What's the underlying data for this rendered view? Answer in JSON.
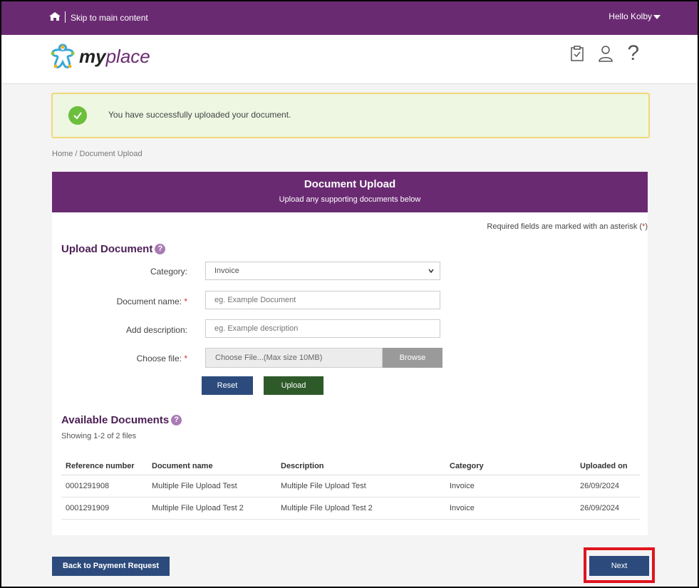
{
  "topbar": {
    "skip": "Skip to main content",
    "greeting": "Hello Kolby"
  },
  "brand": {
    "my": "my",
    "place": "place"
  },
  "alert": {
    "message": "You have successfully uploaded your document."
  },
  "breadcrumb": "Home  /  Document Upload",
  "panel": {
    "title": "Document Upload",
    "subtitle": "Upload any supporting documents below"
  },
  "required_note": {
    "text": "Required fields are marked with an asterisk (",
    "star": "*",
    "end": ")"
  },
  "upload_section": {
    "heading": "Upload Document",
    "help": "?",
    "category_label": "Category:",
    "category_value": "Invoice",
    "doc_name_label": "Document name:",
    "doc_name_placeholder": "eg. Example Document",
    "description_label": "Add description:",
    "description_placeholder": "eg. Example description",
    "file_label": "Choose file:",
    "file_placeholder": "Choose File...(Max size 10MB)",
    "browse": "Browse",
    "star": "*",
    "reset": "Reset",
    "upload": "Upload"
  },
  "documents": {
    "heading": "Available Documents",
    "help": "?",
    "showing": "Showing 1-2 of 2 files",
    "columns": [
      "Reference number",
      "Document name",
      "Description",
      "Category",
      "Uploaded on"
    ],
    "rows": [
      [
        "0001291908",
        "Multiple File Upload Test",
        "Multiple File Upload Test",
        "Invoice",
        "26/09/2024"
      ],
      [
        "0001291909",
        "Multiple File Upload Test 2",
        "Multiple File Upload Test 2",
        "Invoice",
        "26/09/2024"
      ]
    ]
  },
  "footer": {
    "back": "Back to Payment Request",
    "next": "Next"
  },
  "colors": {
    "brand": "#6a2a72",
    "primary": "#2c4b7c",
    "success": "#2e5a2a",
    "highlight": "#e0141e"
  }
}
